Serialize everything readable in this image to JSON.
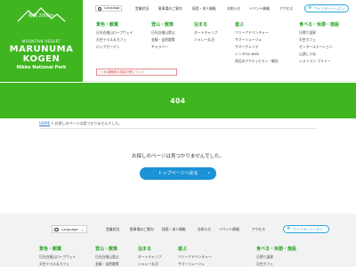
{
  "brand": {
    "altitude": "標高 2000m",
    "resort": "MOUNTAIN RESORT",
    "name_line1": "MARUNUMA",
    "name_line2": "KOGEN",
    "park": "Nikko National Park",
    "green": "#3fb51f"
  },
  "header": {
    "language_label": "Language",
    "top_nav": [
      "営業状況",
      "駐車場のご案内",
      "採用・求人情報",
      "お知らせ",
      "イベント情報",
      "アクセス"
    ],
    "winter_label": "ウインターシーズン",
    "columns": [
      {
        "title": "景色・観賞",
        "items": [
          "日光白根山ロープウェイ",
          "天空テラス＆カフェ",
          "ロックガーデン"
        ]
      },
      {
        "title": "登山・散策",
        "items": [
          "日光白根山登山",
          "金精・自然散策",
          "ギャラリー"
        ]
      },
      {
        "title": "泊まる",
        "items": [
          "オートキャンプ",
          "シャレー丸沼"
        ]
      },
      {
        "title": "遊ぶ",
        "items": [
          "ツリーアドベンチャー",
          "サマーリュージュ",
          "サマーゲレンデ",
          "レンタルE-BIKE",
          "周辺のアクティビティ・観光"
        ]
      },
      {
        "title": "食べる・休憩・施設",
        "items": [
          "日帰り温泉",
          "天空カフェ",
          "センターステーション",
          "山頂しらね",
          "レストラン ブラトー"
        ]
      }
    ],
    "notice": "× 私達職員の感染対策について"
  },
  "banner": {
    "code": "404"
  },
  "breadcrumb": {
    "home": "HOME",
    "separator": ">",
    "current": "お探しのページは見つかりませんでした。"
  },
  "main": {
    "message": "お探しのページは見つかりませんでした。",
    "top_button": "トップページへ戻る",
    "top_button_arrow": "›"
  },
  "footer": {
    "language_label": "Language",
    "top_nav": [
      "営業状況",
      "駐車場のご案内",
      "採用・求人情報",
      "お知らせ",
      "イベント情報",
      "アクセス"
    ],
    "winter_label": "ウインターシーズン",
    "columns": [
      {
        "title": "景色・観賞",
        "items": [
          "日光白根山ロープウェイ",
          "天空テラス＆カフェ"
        ]
      },
      {
        "title": "登山・散策",
        "items": [
          "日光白根山登山",
          "金精・自然散策"
        ]
      },
      {
        "title": "泊まる",
        "items": [
          "オートキャンプ",
          "シャレー丸沼"
        ]
      },
      {
        "title": "遊ぶ",
        "items": [
          "ツリーアドベンチャー",
          "サマーリュージュ"
        ]
      },
      {
        "title": "食べる・休憩・施設",
        "items": [
          "日帰り温泉",
          "天空カフェ"
        ]
      }
    ]
  },
  "icons": {
    "language": "globe-icon",
    "winter": "snowflake-icon",
    "arrow": "chevron-right-icon"
  },
  "colors": {
    "accent_green": "#3fb51f",
    "heading_green": "#2aa42a",
    "button_blue": "#1b93d6",
    "winter_blue": "#27a4dd",
    "notice_red": "#d04848"
  }
}
